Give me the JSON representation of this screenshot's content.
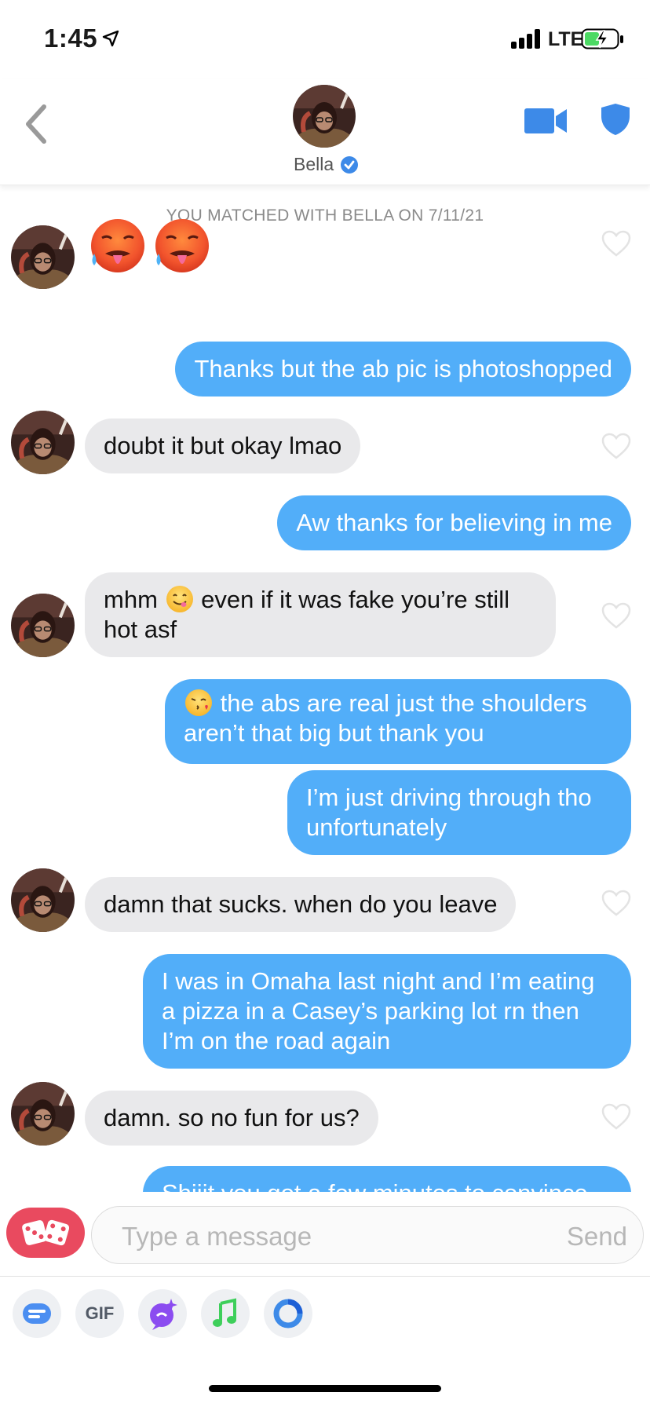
{
  "status_bar": {
    "time": "1:45",
    "network": "LTE"
  },
  "header": {
    "name": "Bella",
    "back_icon": "chevron-left-icon",
    "video_icon": "video-camera-icon",
    "safety_icon": "shield-icon"
  },
  "chat": {
    "match_notice": "YOU MATCHED WITH BELLA ON 7/11/21",
    "messages": [
      {
        "from": "them",
        "emoji_only": true,
        "emoji": "hot-face-emoji x2"
      },
      {
        "from": "me",
        "text": "Thanks but the ab pic is photoshopped"
      },
      {
        "from": "them",
        "text": "doubt it but okay lmao"
      },
      {
        "from": "me",
        "text": "Aw thanks for believing in me"
      },
      {
        "from": "them",
        "text_before_emoji": "mhm",
        "text_after_emoji": "even if it was fake you’re still",
        "text_line2": "hot asf"
      },
      {
        "from": "me",
        "text_after_emoji": "the abs are real just the shoulders",
        "text_line2": "aren’t that big but thank you"
      },
      {
        "from": "me",
        "text": "I’m just driving through tho",
        "text_line2": "unfortunately"
      },
      {
        "from": "them",
        "text": "damn that sucks. when do you leave"
      },
      {
        "from": "me",
        "text": "I was in Omaha last night and I’m eating",
        "text_line2": "a pizza in a Casey’s parking lot rn then",
        "text_line3": "I’m on the road again"
      },
      {
        "from": "them",
        "text": "damn. so no fun for us?"
      },
      {
        "from": "me",
        "text": "Shiiit you got a few minutes to convince"
      }
    ]
  },
  "composer": {
    "placeholder": "Type a message",
    "send_label": "Send"
  },
  "tools": [
    {
      "icon": "sticker-card-icon"
    },
    {
      "icon": "gif-icon",
      "label": "GIF"
    },
    {
      "icon": "sparkle-bubble-icon"
    },
    {
      "icon": "music-note-icon"
    },
    {
      "icon": "ring-icon"
    }
  ],
  "colors": {
    "outgoing": "#52aef9",
    "incoming": "#e9e9eb",
    "brand_blue": "#3d8ae8",
    "dice": "#e94a5f"
  }
}
